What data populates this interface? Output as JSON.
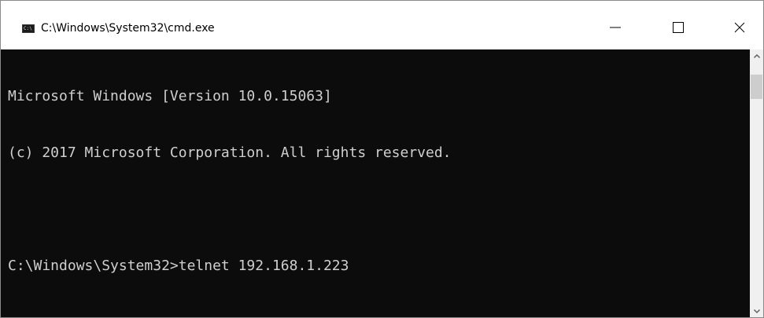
{
  "window": {
    "title": "C:\\Windows\\System32\\cmd.exe",
    "icon_name": "cmd-icon",
    "icon_text": "C:\\"
  },
  "console": {
    "lines": [
      "Microsoft Windows [Version 10.0.15063]",
      "(c) 2017 Microsoft Corporation. All rights reserved.",
      "",
      "C:\\Windows\\System32>telnet 192.168.1.223"
    ]
  },
  "colors": {
    "console_background": "#0c0c0c",
    "console_text": "#cfcfcf",
    "titlebar_background": "#ffffff",
    "scrollbar_track": "#f0f0f0",
    "scrollbar_thumb": "#cdcdcd"
  },
  "icons": {
    "minimize": "minimize-icon",
    "maximize": "maximize-icon",
    "close": "close-icon",
    "scroll_up": "chevron-up-icon",
    "scroll_down": "chevron-down-icon"
  }
}
